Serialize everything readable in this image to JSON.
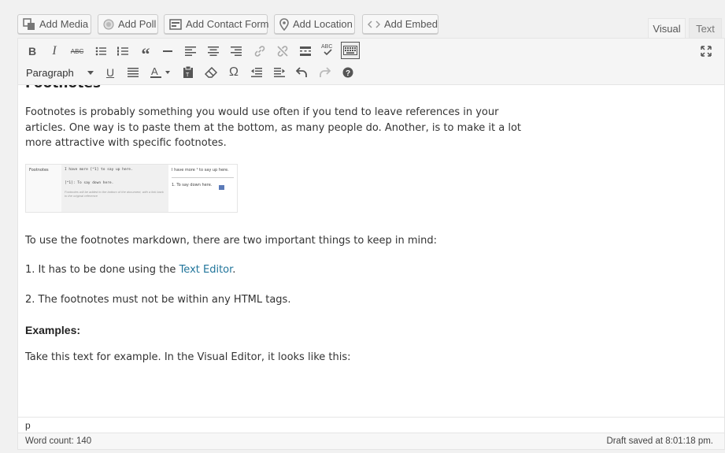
{
  "media_buttons": [
    {
      "label": "Add Media",
      "icon": "media-icon"
    },
    {
      "label": "Add Poll",
      "icon": "poll-icon"
    },
    {
      "label": "Add Contact Form",
      "icon": "form-icon"
    },
    {
      "label": "Add Location",
      "icon": "location-pin-icon"
    },
    {
      "label": "Add Embed",
      "icon": "embed-icon"
    }
  ],
  "tabs": {
    "visual": "Visual",
    "text": "Text"
  },
  "toolbar": {
    "format_select": "Paragraph",
    "row1_icons": [
      "bold-icon",
      "italic-icon",
      "strikethrough-icon",
      "bullet-list-icon",
      "numbered-list-icon",
      "blockquote-icon",
      "horizontal-rule-icon",
      "align-left-icon",
      "align-center-icon",
      "align-right-icon",
      "link-icon",
      "unlink-icon",
      "read-more-icon",
      "spellcheck-icon",
      "toolbar-toggle-icon",
      "fullscreen-icon"
    ],
    "row2_icons": [
      "underline-icon",
      "justify-icon",
      "text-color-icon",
      "paste-text-icon",
      "clear-formatting-icon",
      "special-character-icon",
      "outdent-icon",
      "indent-icon",
      "undo-icon",
      "redo-icon",
      "help-icon"
    ]
  },
  "content": {
    "heading_partial": "Footnotes",
    "intro": "Footnotes is probably something you would use often if you tend to leave references in your articles. One way is to paste them at the bottom, as many people do. Another, is to make it a lot more attractive with specific footnotes.",
    "image": {
      "col1": "Footnotes",
      "code1": "I have more [^1] to say up here.",
      "code2": "[^1]: To say down here.",
      "note": "Footnotes will be added to the bottom of the document, with a link back to the original reference",
      "rendered1": "I have more ¹ to say up here.",
      "rendered2": "1.  To say down here."
    },
    "p2": "To use the footnotes markdown, there are two important things to keep in mind:",
    "p3_prefix": "1. It has to be done using the ",
    "p3_link": "Text Editor",
    "p3_suffix": ".",
    "p4": "2. The footnotes must not be within any HTML tags.",
    "h2": "Examples:",
    "p5": "Take this text for example. In the Visual Editor, it looks like this:"
  },
  "path": "p",
  "status": {
    "word_count": "Word count: 140",
    "draft": "Draft saved at 8:01:18 pm."
  },
  "colors": {
    "link": "#21759b",
    "toolbar_bg": "#f5f5f5"
  }
}
